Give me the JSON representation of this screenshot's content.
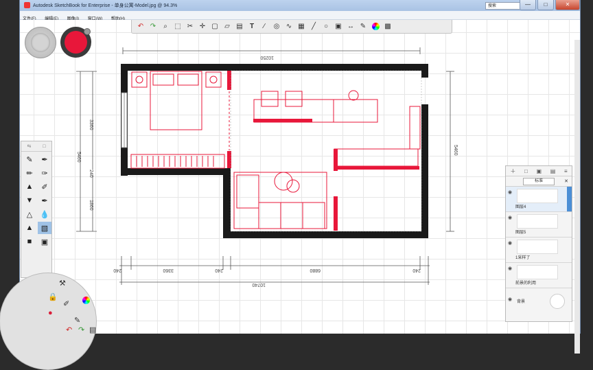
{
  "window": {
    "title": "Autodesk SketchBook for Enterprise - 单身公寓-Model.jpg @ 94.3%",
    "minimize": "—",
    "maximize": "□",
    "close": "✕"
  },
  "menu": [
    "文件(F)",
    "编辑(E)",
    "图像(I)",
    "窗口(W)",
    "帮助(H)"
  ],
  "search": {
    "placeholder": "搜索"
  },
  "toolbar": {
    "icons": [
      "undo-icon",
      "redo-icon",
      "zoom-icon",
      "select-icon",
      "crop-icon",
      "move-icon",
      "transform-icon",
      "distort-icon",
      "fill-icon",
      "text-icon",
      "ruler-icon",
      "ellipse-guide-icon",
      "french-curve-icon",
      "perspective-icon",
      "line-icon",
      "curve-icon",
      "shape-icon",
      "symmetry-icon",
      "brush-library-icon",
      "color-wheel-icon",
      "copic-icon"
    ]
  },
  "layers": {
    "blend_mode": "标准",
    "items": [
      {
        "name": "图层4",
        "active": true
      },
      {
        "name": "图层5",
        "active": false
      },
      {
        "name": "1采样了",
        "active": false
      },
      {
        "name": "前景的利用",
        "active": false
      }
    ],
    "background_label": "背景"
  },
  "drawing": {
    "dims": {
      "top": "10250",
      "left_upper": "3360",
      "left_mid": "240",
      "left_lower": "1860",
      "left_total": "5460",
      "right_total": "5460",
      "bottom_a": "240",
      "bottom_b": "3360",
      "bottom_c": "240",
      "bottom_d": "6880",
      "bottom_e": "240",
      "bottom_total": "10740"
    },
    "accent_color": "#e8173a",
    "wall_color": "#1a1a1a"
  },
  "colors": {
    "brush_color": "#e8173a"
  }
}
